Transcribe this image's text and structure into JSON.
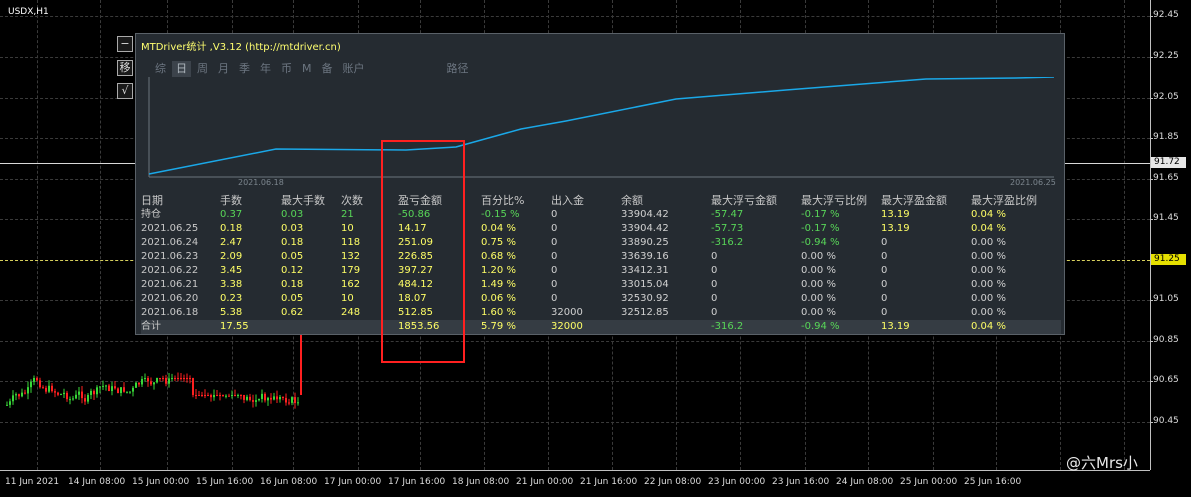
{
  "chart": {
    "symbol": "USDX,H1",
    "y_ticks": [
      "92.45",
      "92.25",
      "92.05",
      "91.85",
      "91.65",
      "91.45",
      "91.05",
      "90.85",
      "90.65",
      "90.45"
    ],
    "price_current_white": "91.72",
    "price_current_yellow": "91.25",
    "x_ticks": [
      "11 Jun 2021",
      "14 Jun 08:00",
      "15 Jun 00:00",
      "15 Jun 16:00",
      "16 Jun 08:00",
      "17 Jun 00:00",
      "17 Jun 16:00",
      "18 Jun 08:00",
      "21 Jun 00:00",
      "21 Jun 16:00",
      "22 Jun 08:00",
      "23 Jun 00:00",
      "23 Jun 16:00",
      "24 Jun 08:00",
      "25 Jun 00:00",
      "25 Jun 16:00"
    ],
    "colors": {
      "bull": "#38d838",
      "bear": "#ff2020",
      "grid": "#3a3a3a",
      "axis": "#c0c0c0",
      "yellow_line": "#d6cf5c"
    }
  },
  "side_buttons": {
    "minimize": "−",
    "move": "移",
    "check": "√"
  },
  "panel": {
    "title": "MTDriver统计 ,V3.12 (http://mtdriver.cn)",
    "tabs": [
      "综",
      "日",
      "周",
      "月",
      "季",
      "年",
      "币",
      "M",
      "备",
      "账户",
      "路径"
    ],
    "active_tab": "日",
    "equity_labels": {
      "start": "2021.06.18",
      "end": "2021.06.25"
    },
    "equity_color": "#1aa8e8",
    "headers": [
      "日期",
      "手数",
      "最大手数",
      "次数",
      "盈亏金额",
      "百分比%",
      "出入金",
      "余额",
      "最大浮亏金额",
      "最大浮亏比例",
      "最大浮盈金额",
      "最大浮盈比例"
    ],
    "rows": [
      [
        "持仓",
        "0.37",
        "0.03",
        "21",
        "-50.86",
        "-0.15 %",
        "0",
        "33904.42",
        "-57.47",
        "-0.17 %",
        "13.19",
        "0.04 %"
      ],
      [
        "2021.06.25",
        "0.18",
        "0.03",
        "10",
        "14.17",
        "0.04 %",
        "0",
        "33904.42",
        "-57.73",
        "-0.17 %",
        "13.19",
        "0.04 %"
      ],
      [
        "2021.06.24",
        "2.47",
        "0.18",
        "118",
        "251.09",
        "0.75 %",
        "0",
        "33890.25",
        "-316.2",
        "-0.94 %",
        "0",
        "0.00 %"
      ],
      [
        "2021.06.23",
        "2.09",
        "0.05",
        "132",
        "226.85",
        "0.68 %",
        "0",
        "33639.16",
        "0",
        "0.00 %",
        "0",
        "0.00 %"
      ],
      [
        "2021.06.22",
        "3.45",
        "0.12",
        "179",
        "397.27",
        "1.20 %",
        "0",
        "33412.31",
        "0",
        "0.00 %",
        "0",
        "0.00 %"
      ],
      [
        "2021.06.21",
        "3.38",
        "0.18",
        "162",
        "484.12",
        "1.49 %",
        "0",
        "33015.04",
        "0",
        "0.00 %",
        "0",
        "0.00 %"
      ],
      [
        "2021.06.20",
        "0.23",
        "0.05",
        "10",
        "18.07",
        "0.06 %",
        "0",
        "32530.92",
        "0",
        "0.00 %",
        "0",
        "0.00 %"
      ],
      [
        "2021.06.18",
        "5.38",
        "0.62",
        "248",
        "512.85",
        "1.60 %",
        "32000",
        "32512.85",
        "0",
        "0.00 %",
        "0",
        "0.00 %"
      ]
    ],
    "total": [
      "合计",
      "17.55",
      "",
      "",
      "1853.56",
      "5.79 %",
      "32000",
      "",
      "-316.2",
      "-0.94 %",
      "13.19",
      "0.04 %"
    ]
  },
  "watermark": "@六Mrs小"
}
